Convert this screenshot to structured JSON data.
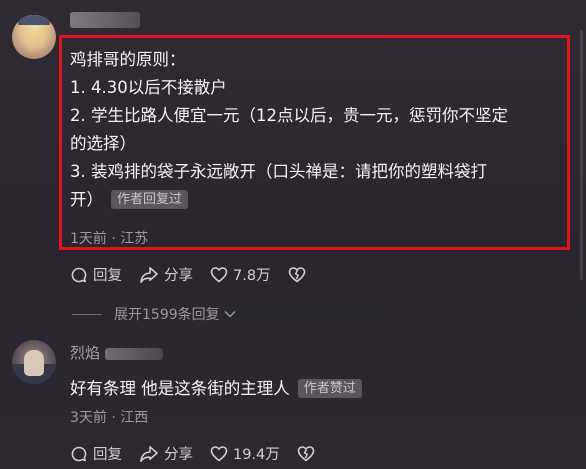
{
  "comment1": {
    "lines": [
      "鸡排哥的原则：",
      "1. 4.30以后不接散户",
      "2. 学生比路人便宜一元（12点以后，贵一元，惩罚你不坚定",
      "的选择）",
      "3. 装鸡排的袋子永远敞开（口头禅是：请把你的塑料袋打",
      "开）"
    ],
    "author_tag": "作者回复过",
    "meta": "1天前 · 江苏",
    "reply_label": "回复",
    "share_label": "分享",
    "like_count": "7.8万",
    "expand_label": "展开1599条回复"
  },
  "comment2": {
    "username_partial": "烈焰",
    "text": "好有条理 他是这条街的主理人",
    "author_tag": "作者赞过",
    "meta": "3天前 · 江西",
    "reply_label": "回复",
    "share_label": "分享",
    "like_count": "19.4万"
  },
  "colors": {
    "background": "#2b252e",
    "highlight_border": "#e0141d",
    "text_primary": "#f4f4f4",
    "text_secondary": "#9c98a0",
    "tag_bg": "#5a5560"
  },
  "icons": [
    "comment-icon",
    "share-icon",
    "heart-icon",
    "broken-heart-icon",
    "chevron-down-icon"
  ]
}
